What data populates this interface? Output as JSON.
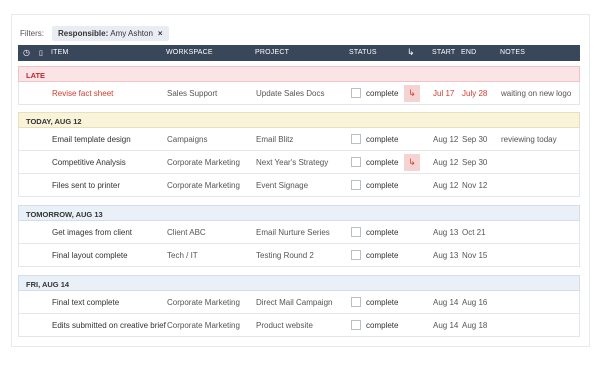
{
  "filters": {
    "label": "Filters:",
    "chip_key": "Responsible:",
    "chip_value": "Amy Ashton",
    "chip_close": "×"
  },
  "columns": {
    "clock_icon": "◷",
    "clip_icon": "▯",
    "item": "ITEM",
    "workspace": "WORKSPACE",
    "project": "PROJECT",
    "status": "STATUS",
    "dep_icon": "↳",
    "start": "START",
    "end": "END",
    "notes": "NOTES"
  },
  "groups": {
    "late": "LATE",
    "today": "TODAY, AUG 12",
    "tomorrow": "TOMORROW, AUG 13",
    "fri": "FRI, AUG 14"
  },
  "rows": [
    {
      "item": "Revise fact sheet",
      "workspace": "Sales Support",
      "project": "Update Sales Docs",
      "status": "complete",
      "dep": "↳",
      "start": "Jul 17",
      "end": "July 28",
      "notes": "waiting on new logo"
    },
    {
      "item": "Email template design",
      "workspace": "Campaigns",
      "project": "Email Blitz",
      "status": "complete",
      "start": "Aug 12",
      "end": "Sep 30",
      "notes": "reviewing today"
    },
    {
      "item": "Competitive Analysis",
      "workspace": "Corporate Marketing",
      "project": "Next Year's Strategy",
      "status": "complete",
      "dep": "↳",
      "start": "Aug 12",
      "end": "Sep 30",
      "notes": ""
    },
    {
      "item": "Files sent to printer",
      "workspace": "Corporate Marketing",
      "project": "Event Signage",
      "status": "complete",
      "start": "Aug 12",
      "end": "Nov 12",
      "notes": ""
    },
    {
      "item": "Get images from client",
      "workspace": "Client ABC",
      "project": "Email Nurture Series",
      "status": "complete",
      "start": "Aug 13",
      "end": "Oct 21",
      "notes": ""
    },
    {
      "item": "Final layout complete",
      "workspace": "Tech / IT",
      "project": "Testing Round 2",
      "status": "complete",
      "start": "Aug 13",
      "end": "Nov 15",
      "notes": ""
    },
    {
      "item": "Final text complete",
      "workspace": "Corporate Marketing",
      "project": "Direct Mail Campaign",
      "status": "complete",
      "start": "Aug 14",
      "end": "Aug 16",
      "notes": ""
    },
    {
      "item": "Edits submitted on creative brief",
      "workspace": "Corporate Marketing",
      "project": "Product website",
      "status": "complete",
      "start": "Aug 14",
      "end": "Aug 18",
      "notes": ""
    }
  ],
  "colors": {
    "header_bg": "#39475b",
    "late_text": "#d23a2c",
    "late_bg": "#fbe4e6",
    "today_bg": "#f9f3d9",
    "day_bg": "#eaf0f8"
  }
}
